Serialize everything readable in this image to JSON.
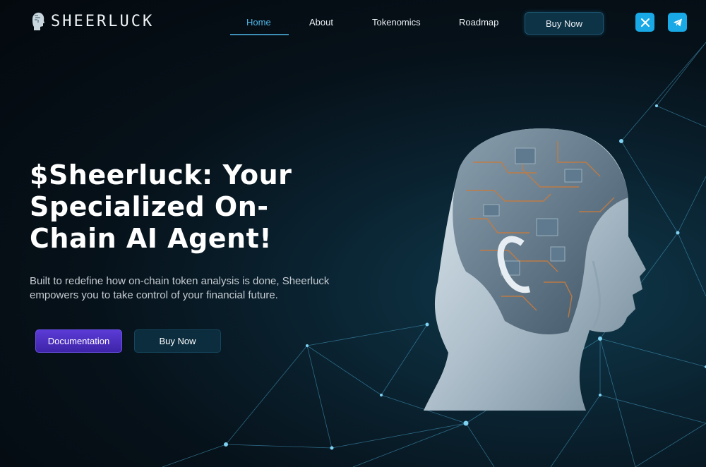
{
  "brand": {
    "name": "SHEERLUCK",
    "logo_icon": "head-logo-icon"
  },
  "nav": {
    "items": [
      {
        "label": "Home",
        "active": true
      },
      {
        "label": "About",
        "active": false
      },
      {
        "label": "Tokenomics",
        "active": false
      },
      {
        "label": "Roadmap",
        "active": false
      }
    ],
    "buy_label": "Buy Now"
  },
  "social": {
    "x_icon": "x-icon",
    "telegram_icon": "telegram-icon"
  },
  "hero": {
    "title": "$Sheerluck: Your Specialized On-Chain AI Agent!",
    "description": "Built to redefine how on-chain token analysis is done, Sheerluck empowers you to take control of your financial future.",
    "docs_button": "Documentation",
    "buy_button": "Buy Now"
  },
  "colors": {
    "accent": "#4fb7e8",
    "docs_button": "#4a2dc0",
    "buy_button": "#0b2d3e",
    "social": "#18a9e6",
    "background": "#061119"
  }
}
